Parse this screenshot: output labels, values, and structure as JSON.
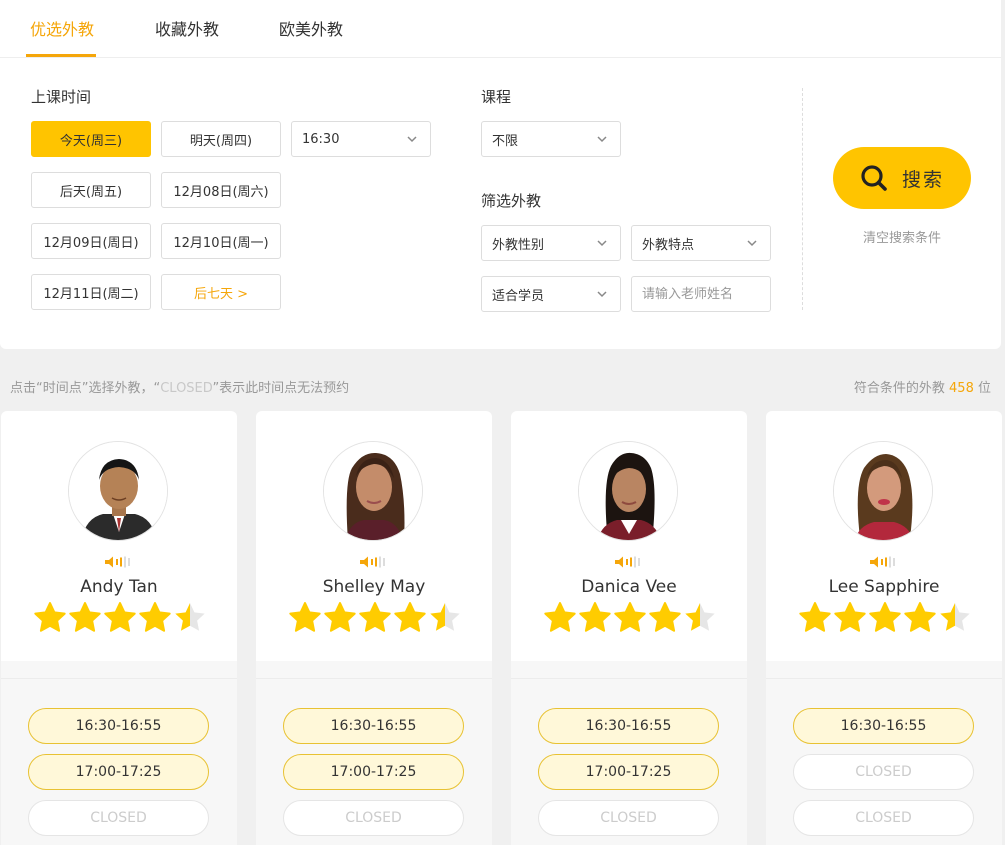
{
  "tabs": [
    {
      "label": "优选外教",
      "active": true
    },
    {
      "label": "收藏外教",
      "active": false
    },
    {
      "label": "欧美外教",
      "active": false
    }
  ],
  "filters": {
    "time_title": "上课时间",
    "day_buttons": [
      "今天(周三)",
      "明天(周四)",
      "后天(周五)",
      "12月08日(周六)",
      "12月09日(周日)",
      "12月10日(周一)",
      "12月11日(周二)"
    ],
    "more_days": "后七天 >",
    "time_select": "16:30",
    "course_title": "课程",
    "course_select": "不限",
    "teacher_filter_title": "筛选外教",
    "gender_select": "外教性别",
    "feature_select": "外教特点",
    "student_select": "适合学员",
    "name_placeholder": "请输入老师姓名"
  },
  "search": {
    "label": "搜索",
    "clear": "清空搜索条件"
  },
  "hint": {
    "prefix": "点击“时间点”选择外教，“",
    "closed_word": "CLOSED",
    "suffix": "”表示此时间点无法预约"
  },
  "result_count": {
    "prefix": "符合条件的外教 ",
    "count": "458",
    "suffix": " 位"
  },
  "colors": {
    "accent": "#ffc400",
    "orange": "#f5a60a",
    "star": "#ffcc00"
  },
  "teachers": [
    {
      "name": "Andy Tan",
      "rating": 4.5,
      "slots": [
        "16:30-16:55",
        "17:00-17:25",
        "CLOSED"
      ],
      "slot_open": [
        true,
        true,
        false
      ]
    },
    {
      "name": "Shelley May",
      "rating": 4.5,
      "slots": [
        "16:30-16:55",
        "17:00-17:25",
        "CLOSED"
      ],
      "slot_open": [
        true,
        true,
        false
      ]
    },
    {
      "name": "Danica Vee",
      "rating": 4.5,
      "slots": [
        "16:30-16:55",
        "17:00-17:25",
        "CLOSED"
      ],
      "slot_open": [
        true,
        true,
        false
      ]
    },
    {
      "name": "Lee Sapphire",
      "rating": 4.5,
      "slots": [
        "16:30-16:55",
        "CLOSED",
        "CLOSED"
      ],
      "slot_open": [
        true,
        false,
        false
      ]
    }
  ]
}
